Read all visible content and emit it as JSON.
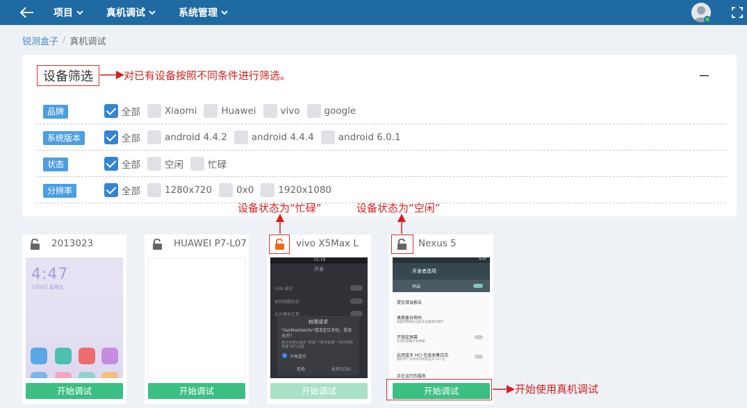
{
  "nav": {
    "back_icon": "arrow-left-icon",
    "menus": [
      {
        "label": "项目"
      },
      {
        "label": "真机调试"
      },
      {
        "label": "系统管理"
      }
    ],
    "avatar_icon": "user-avatar-icon",
    "fullscreen_icon": "fullscreen-icon",
    "colors": {
      "bar": "#1f6aa3",
      "online": "#3fcf5f"
    }
  },
  "breadcrumb": {
    "items": [
      {
        "label": "锐测盒子"
      },
      {
        "label": "真机调试"
      }
    ],
    "separator": "/"
  },
  "filter_panel": {
    "title": "设备筛选",
    "collapse_icon": "minus-icon",
    "rows": [
      {
        "tag": "品牌",
        "options": [
          {
            "label": "全部",
            "checked": true
          },
          {
            "label": "Xiaomi",
            "checked": false
          },
          {
            "label": "Huawei",
            "checked": false
          },
          {
            "label": "vivo",
            "checked": false
          },
          {
            "label": "google",
            "checked": false
          }
        ]
      },
      {
        "tag": "系统版本",
        "options": [
          {
            "label": "全部",
            "checked": true
          },
          {
            "label": "android 4.4.2",
            "checked": false
          },
          {
            "label": "android 4.4.4",
            "checked": false
          },
          {
            "label": "android 6.0.1",
            "checked": false
          }
        ]
      },
      {
        "tag": "状态",
        "options": [
          {
            "label": "全部",
            "checked": true
          },
          {
            "label": "空闲",
            "checked": false
          },
          {
            "label": "忙碌",
            "checked": false
          }
        ]
      },
      {
        "tag": "分辨率",
        "options": [
          {
            "label": "全部",
            "checked": true
          },
          {
            "label": "1280x720",
            "checked": false
          },
          {
            "label": "0x0",
            "checked": false
          },
          {
            "label": "1920x1080",
            "checked": false
          }
        ]
      }
    ]
  },
  "annotations": {
    "filter_note": "对已有设备按照不同条件进行筛选。",
    "busy_note": "设备状态为“忙碌”",
    "idle_note": "设备状态为“空闲”",
    "start_note": "开始使用真机调试",
    "color": "#d21f1f"
  },
  "devices": [
    {
      "name": "2013023",
      "lock_icon": "unlock-icon",
      "busy": false,
      "button": "开始调试",
      "button_enabled": true,
      "screen": {
        "time": "4:47",
        "date": "2月6日 星期五"
      }
    },
    {
      "name": "HUAWEI P7-L07",
      "lock_icon": "unlock-icon",
      "busy": false,
      "button": "开始调试",
      "button_enabled": true,
      "screen": {}
    },
    {
      "name": "vivo X5Max L",
      "lock_icon": "unlock-icon-busy",
      "busy": true,
      "button": "开始调试",
      "button_enabled": false,
      "screen": {
        "status_time": "15:18",
        "title": "开发",
        "rows": [
          "USB 调试",
          "保持唤醒状态",
          "允许模拟位置"
        ],
        "dialog_title": "权限请求",
        "dialog_body": "\"GetMobileInfo\"请求定位手机，是否允许？",
        "dialog_hint": "若允许将以通过“i管家”-“软件管理”-“软件权限管理”进行设置",
        "dialog_check": "不再提示",
        "dialog_deny": "拒绝",
        "dialog_allow": "允许(17s)"
      }
    },
    {
      "name": "Nexus 5",
      "lock_icon": "unlock-icon",
      "busy": false,
      "button": "开始调试",
      "button_enabled": true,
      "screen": {
        "status_time": "4:47",
        "header": "开发者选项",
        "toggle_label": "开启",
        "items": [
          {
            "title": "提交错误报告",
            "sub": ""
          },
          {
            "title": "桌面备份密码",
            "sub": "桌面完整备份当前未设置密码保护"
          },
          {
            "title": "不锁定屏幕",
            "sub": "充电时屏幕不会休眠"
          },
          {
            "title": "启用蓝牙 HCI 信息收集日志",
            "sub": "捕获单个文件中的所有蓝牙 HCI 包"
          },
          {
            "title": "正在运行的服务",
            "sub": ""
          }
        ]
      }
    }
  ]
}
